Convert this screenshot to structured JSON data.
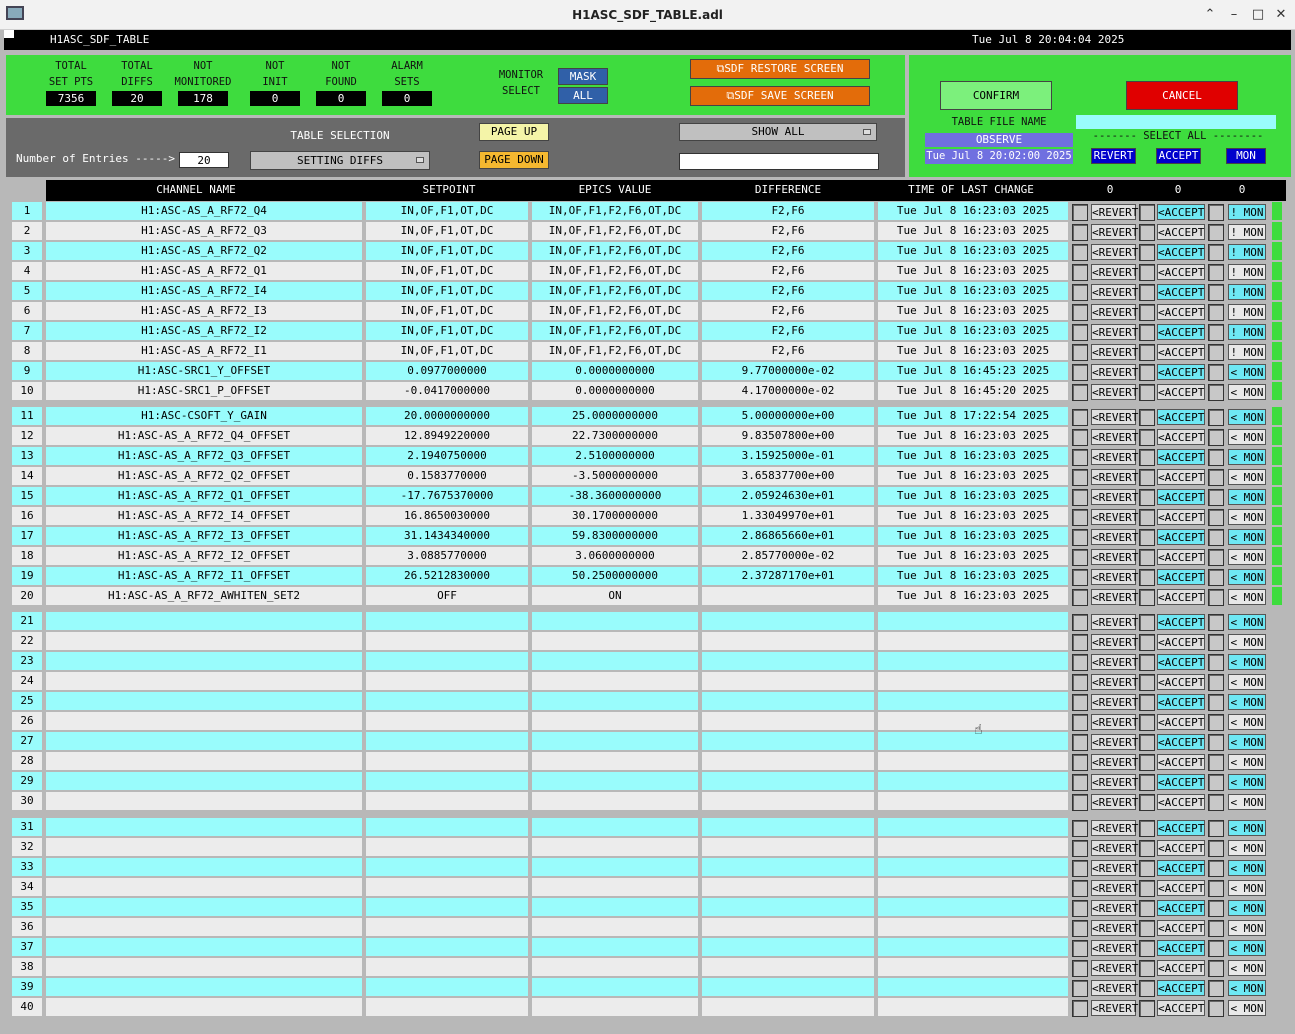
{
  "window": {
    "title": "H1ASC_SDF_TABLE.adl"
  },
  "topbar": {
    "name": "H1ASC_SDF_TABLE",
    "datetime": "Tue Jul  8 20:04:04 2025"
  },
  "stats": [
    {
      "label1": "TOTAL",
      "label2": "SET PTS",
      "value": "7356"
    },
    {
      "label1": "TOTAL",
      "label2": "DIFFS",
      "value": "20"
    },
    {
      "label1": "NOT",
      "label2": "MONITORED",
      "value": "178"
    },
    {
      "label1": "NOT",
      "label2": "INIT",
      "value": "0"
    },
    {
      "label1": "NOT",
      "label2": "FOUND",
      "value": "0"
    },
    {
      "label1": "ALARM",
      "label2": "SETS",
      "value": "0"
    }
  ],
  "monitor": {
    "label1": "MONITOR",
    "label2": "SELECT",
    "mask": "MASK",
    "all": "ALL"
  },
  "sdf": {
    "restore": "SDF RESTORE SCREEN",
    "save": "SDF SAVE SCREEN"
  },
  "right": {
    "confirm": "CONFIRM",
    "cancel": "CANCEL",
    "table_file_label": "TABLE FILE NAME",
    "file_value": "OBSERVE",
    "file_time": "Tue Jul  8 20:02:00 2025",
    "select_all": "------- SELECT ALL --------",
    "revert": "REVERT",
    "accept": "ACCEPT",
    "mon": "MON"
  },
  "controls": {
    "entries_label": "Number of Entries ----->",
    "entries_value": "20",
    "table_selection": "TABLE SELECTION",
    "table_select_value": "SETTING DIFFS",
    "page_up": "PAGE UP",
    "page_down": "PAGE DOWN",
    "show_all": "SHOW ALL",
    "filter_value": ""
  },
  "columns": {
    "channel": "CHANNEL NAME",
    "setpoint": "SETPOINT",
    "epics": "EPICS VALUE",
    "difference": "DIFFERENCE",
    "time": "TIME OF LAST CHANGE",
    "count1": "0",
    "count2": "0",
    "count3": "0"
  },
  "row_buttons": {
    "revert": "<REVERT",
    "accept": "<ACCEPT",
    "mon_bang": "! MON",
    "mon_lt": "< MON"
  },
  "rows": [
    {
      "n": "1",
      "channel": "H1:ASC-AS_A_RF72_Q4",
      "setpoint": "IN,OF,F1,OT,DC",
      "epics": "IN,OF,F1,F2,F6,OT,DC",
      "diff": "F2,F6",
      "time": "Tue Jul  8 16:23:03 2025",
      "mon": "! MON"
    },
    {
      "n": "2",
      "channel": "H1:ASC-AS_A_RF72_Q3",
      "setpoint": "IN,OF,F1,OT,DC",
      "epics": "IN,OF,F1,F2,F6,OT,DC",
      "diff": "F2,F6",
      "time": "Tue Jul  8 16:23:03 2025",
      "mon": "! MON"
    },
    {
      "n": "3",
      "channel": "H1:ASC-AS_A_RF72_Q2",
      "setpoint": "IN,OF,F1,OT,DC",
      "epics": "IN,OF,F1,F2,F6,OT,DC",
      "diff": "F2,F6",
      "time": "Tue Jul  8 16:23:03 2025",
      "mon": "! MON"
    },
    {
      "n": "4",
      "channel": "H1:ASC-AS_A_RF72_Q1",
      "setpoint": "IN,OF,F1,OT,DC",
      "epics": "IN,OF,F1,F2,F6,OT,DC",
      "diff": "F2,F6",
      "time": "Tue Jul  8 16:23:03 2025",
      "mon": "! MON"
    },
    {
      "n": "5",
      "channel": "H1:ASC-AS_A_RF72_I4",
      "setpoint": "IN,OF,F1,OT,DC",
      "epics": "IN,OF,F1,F2,F6,OT,DC",
      "diff": "F2,F6",
      "time": "Tue Jul  8 16:23:03 2025",
      "mon": "! MON"
    },
    {
      "n": "6",
      "channel": "H1:ASC-AS_A_RF72_I3",
      "setpoint": "IN,OF,F1,OT,DC",
      "epics": "IN,OF,F1,F2,F6,OT,DC",
      "diff": "F2,F6",
      "time": "Tue Jul  8 16:23:03 2025",
      "mon": "! MON"
    },
    {
      "n": "7",
      "channel": "H1:ASC-AS_A_RF72_I2",
      "setpoint": "IN,OF,F1,OT,DC",
      "epics": "IN,OF,F1,F2,F6,OT,DC",
      "diff": "F2,F6",
      "time": "Tue Jul  8 16:23:03 2025",
      "mon": "! MON"
    },
    {
      "n": "8",
      "channel": "H1:ASC-AS_A_RF72_I1",
      "setpoint": "IN,OF,F1,OT,DC",
      "epics": "IN,OF,F1,F2,F6,OT,DC",
      "diff": "F2,F6",
      "time": "Tue Jul  8 16:23:03 2025",
      "mon": "! MON"
    },
    {
      "n": "9",
      "channel": "H1:ASC-SRC1_Y_OFFSET",
      "setpoint": "0.0977000000",
      "epics": "0.0000000000",
      "diff": "9.77000000e-02",
      "time": "Tue Jul  8 16:45:23 2025",
      "mon": "< MON"
    },
    {
      "n": "10",
      "channel": "H1:ASC-SRC1_P_OFFSET",
      "setpoint": "-0.0417000000",
      "epics": "0.0000000000",
      "diff": "4.17000000e-02",
      "time": "Tue Jul  8 16:45:20 2025",
      "mon": "< MON"
    },
    {
      "n": "11",
      "channel": "H1:ASC-CSOFT_Y_GAIN",
      "setpoint": "20.0000000000",
      "epics": "25.0000000000",
      "diff": "5.00000000e+00",
      "time": "Tue Jul  8 17:22:54 2025",
      "mon": "< MON"
    },
    {
      "n": "12",
      "channel": "H1:ASC-AS_A_RF72_Q4_OFFSET",
      "setpoint": "12.8949220000",
      "epics": "22.7300000000",
      "diff": "9.83507800e+00",
      "time": "Tue Jul  8 16:23:03 2025",
      "mon": "< MON"
    },
    {
      "n": "13",
      "channel": "H1:ASC-AS_A_RF72_Q3_OFFSET",
      "setpoint": "2.1940750000",
      "epics": "2.5100000000",
      "diff": "3.15925000e-01",
      "time": "Tue Jul  8 16:23:03 2025",
      "mon": "< MON"
    },
    {
      "n": "14",
      "channel": "H1:ASC-AS_A_RF72_Q2_OFFSET",
      "setpoint": "0.1583770000",
      "epics": "-3.5000000000",
      "diff": "3.65837700e+00",
      "time": "Tue Jul  8 16:23:03 2025",
      "mon": "< MON"
    },
    {
      "n": "15",
      "channel": "H1:ASC-AS_A_RF72_Q1_OFFSET",
      "setpoint": "-17.7675370000",
      "epics": "-38.3600000000",
      "diff": "2.05924630e+01",
      "time": "Tue Jul  8 16:23:03 2025",
      "mon": "< MON"
    },
    {
      "n": "16",
      "channel": "H1:ASC-AS_A_RF72_I4_OFFSET",
      "setpoint": "16.8650030000",
      "epics": "30.1700000000",
      "diff": "1.33049970e+01",
      "time": "Tue Jul  8 16:23:03 2025",
      "mon": "< MON"
    },
    {
      "n": "17",
      "channel": "H1:ASC-AS_A_RF72_I3_OFFSET",
      "setpoint": "31.1434340000",
      "epics": "59.8300000000",
      "diff": "2.86865660e+01",
      "time": "Tue Jul  8 16:23:03 2025",
      "mon": "< MON"
    },
    {
      "n": "18",
      "channel": "H1:ASC-AS_A_RF72_I2_OFFSET",
      "setpoint": "3.0885770000",
      "epics": "3.0600000000",
      "diff": "2.85770000e-02",
      "time": "Tue Jul  8 16:23:03 2025",
      "mon": "< MON"
    },
    {
      "n": "19",
      "channel": "H1:ASC-AS_A_RF72_I1_OFFSET",
      "setpoint": "26.5212830000",
      "epics": "50.2500000000",
      "diff": "2.37287170e+01",
      "time": "Tue Jul  8 16:23:03 2025",
      "mon": "< MON"
    },
    {
      "n": "20",
      "channel": "H1:ASC-AS_A_RF72_AWHITEN_SET2",
      "setpoint": "OFF",
      "epics": "ON",
      "diff": "",
      "time": "Tue Jul  8 16:23:03 2025",
      "mon": "< MON"
    },
    {
      "n": "21",
      "channel": "",
      "setpoint": "",
      "epics": "",
      "diff": "",
      "time": "",
      "mon": "< MON"
    },
    {
      "n": "22",
      "channel": "",
      "setpoint": "",
      "epics": "",
      "diff": "",
      "time": "",
      "mon": "< MON"
    },
    {
      "n": "23",
      "channel": "",
      "setpoint": "",
      "epics": "",
      "diff": "",
      "time": "",
      "mon": "< MON"
    },
    {
      "n": "24",
      "channel": "",
      "setpoint": "",
      "epics": "",
      "diff": "",
      "time": "",
      "mon": "< MON"
    },
    {
      "n": "25",
      "channel": "",
      "setpoint": "",
      "epics": "",
      "diff": "",
      "time": "",
      "mon": "< MON"
    },
    {
      "n": "26",
      "channel": "",
      "setpoint": "",
      "epics": "",
      "diff": "",
      "time": "",
      "mon": "< MON"
    },
    {
      "n": "27",
      "channel": "",
      "setpoint": "",
      "epics": "",
      "diff": "",
      "time": "",
      "mon": "< MON"
    },
    {
      "n": "28",
      "channel": "",
      "setpoint": "",
      "epics": "",
      "diff": "",
      "time": "",
      "mon": "< MON"
    },
    {
      "n": "29",
      "channel": "",
      "setpoint": "",
      "epics": "",
      "diff": "",
      "time": "",
      "mon": "< MON"
    },
    {
      "n": "30",
      "channel": "",
      "setpoint": "",
      "epics": "",
      "diff": "",
      "time": "",
      "mon": "< MON"
    },
    {
      "n": "31",
      "channel": "",
      "setpoint": "",
      "epics": "",
      "diff": "",
      "time": "",
      "mon": "< MON"
    },
    {
      "n": "32",
      "channel": "",
      "setpoint": "",
      "epics": "",
      "diff": "",
      "time": "",
      "mon": "< MON"
    },
    {
      "n": "33",
      "channel": "",
      "setpoint": "",
      "epics": "",
      "diff": "",
      "time": "",
      "mon": "< MON"
    },
    {
      "n": "34",
      "channel": "",
      "setpoint": "",
      "epics": "",
      "diff": "",
      "time": "",
      "mon": "< MON"
    },
    {
      "n": "35",
      "channel": "",
      "setpoint": "",
      "epics": "",
      "diff": "",
      "time": "",
      "mon": "< MON"
    },
    {
      "n": "36",
      "channel": "",
      "setpoint": "",
      "epics": "",
      "diff": "",
      "time": "",
      "mon": "< MON"
    },
    {
      "n": "37",
      "channel": "",
      "setpoint": "",
      "epics": "",
      "diff": "",
      "time": "",
      "mon": "< MON"
    },
    {
      "n": "38",
      "channel": "",
      "setpoint": "",
      "epics": "",
      "diff": "",
      "time": "",
      "mon": "< MON"
    },
    {
      "n": "39",
      "channel": "",
      "setpoint": "",
      "epics": "",
      "diff": "",
      "time": "",
      "mon": "< MON"
    },
    {
      "n": "40",
      "channel": "",
      "setpoint": "",
      "epics": "",
      "diff": "",
      "time": "",
      "mon": "< MON"
    }
  ],
  "colors": {
    "green": "#3edc3e",
    "cyan": "#99fcfc",
    "light": "#ececec",
    "orange": "#e36c0a",
    "red": "#e00000"
  }
}
